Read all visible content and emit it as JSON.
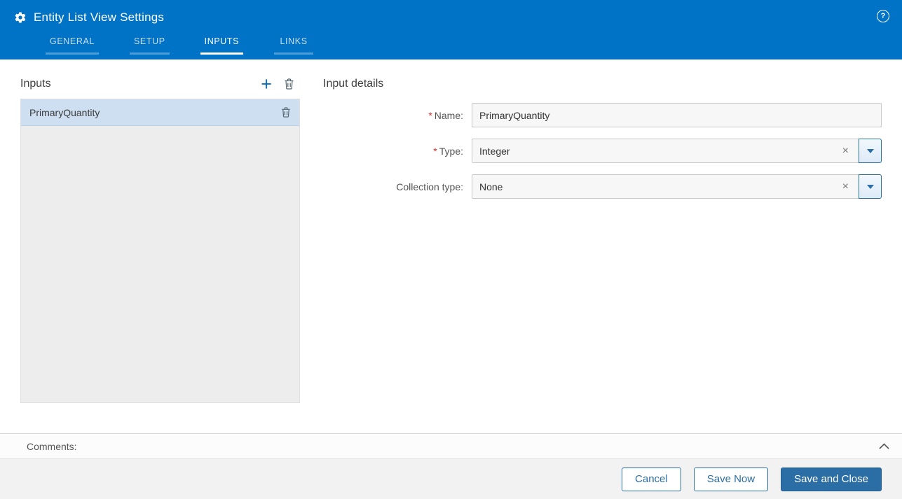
{
  "colors": {
    "header_blue": "#0173c7",
    "accent_blue": "#2b6ea5",
    "required_red": "#c9302c",
    "selected_item_bg": "#cddff0"
  },
  "header": {
    "title": "Entity List View Settings",
    "help_icon": "?",
    "tabs": [
      {
        "label": "GENERAL",
        "active": false
      },
      {
        "label": "SETUP",
        "active": false
      },
      {
        "label": "INPUTS",
        "active": true
      },
      {
        "label": "LINKS",
        "active": false
      }
    ]
  },
  "inputs_panel": {
    "title": "Inputs",
    "add_icon": "+",
    "items": [
      {
        "name": "PrimaryQuantity",
        "selected": true
      }
    ]
  },
  "details_panel": {
    "title": "Input details",
    "required_marker": "*",
    "clear_icon": "×",
    "fields": [
      {
        "label": "Name:",
        "required": true,
        "control": "text",
        "value": "PrimaryQuantity"
      },
      {
        "label": "Type:",
        "required": true,
        "control": "dropdown",
        "value": "Integer"
      },
      {
        "label": "Collection type:",
        "required": false,
        "control": "dropdown",
        "value": "None"
      }
    ]
  },
  "comments": {
    "label": "Comments:"
  },
  "footer": {
    "buttons": [
      {
        "label": "Cancel",
        "style": "secondary"
      },
      {
        "label": "Save Now",
        "style": "secondary"
      },
      {
        "label": "Save and Close",
        "style": "primary"
      }
    ]
  }
}
